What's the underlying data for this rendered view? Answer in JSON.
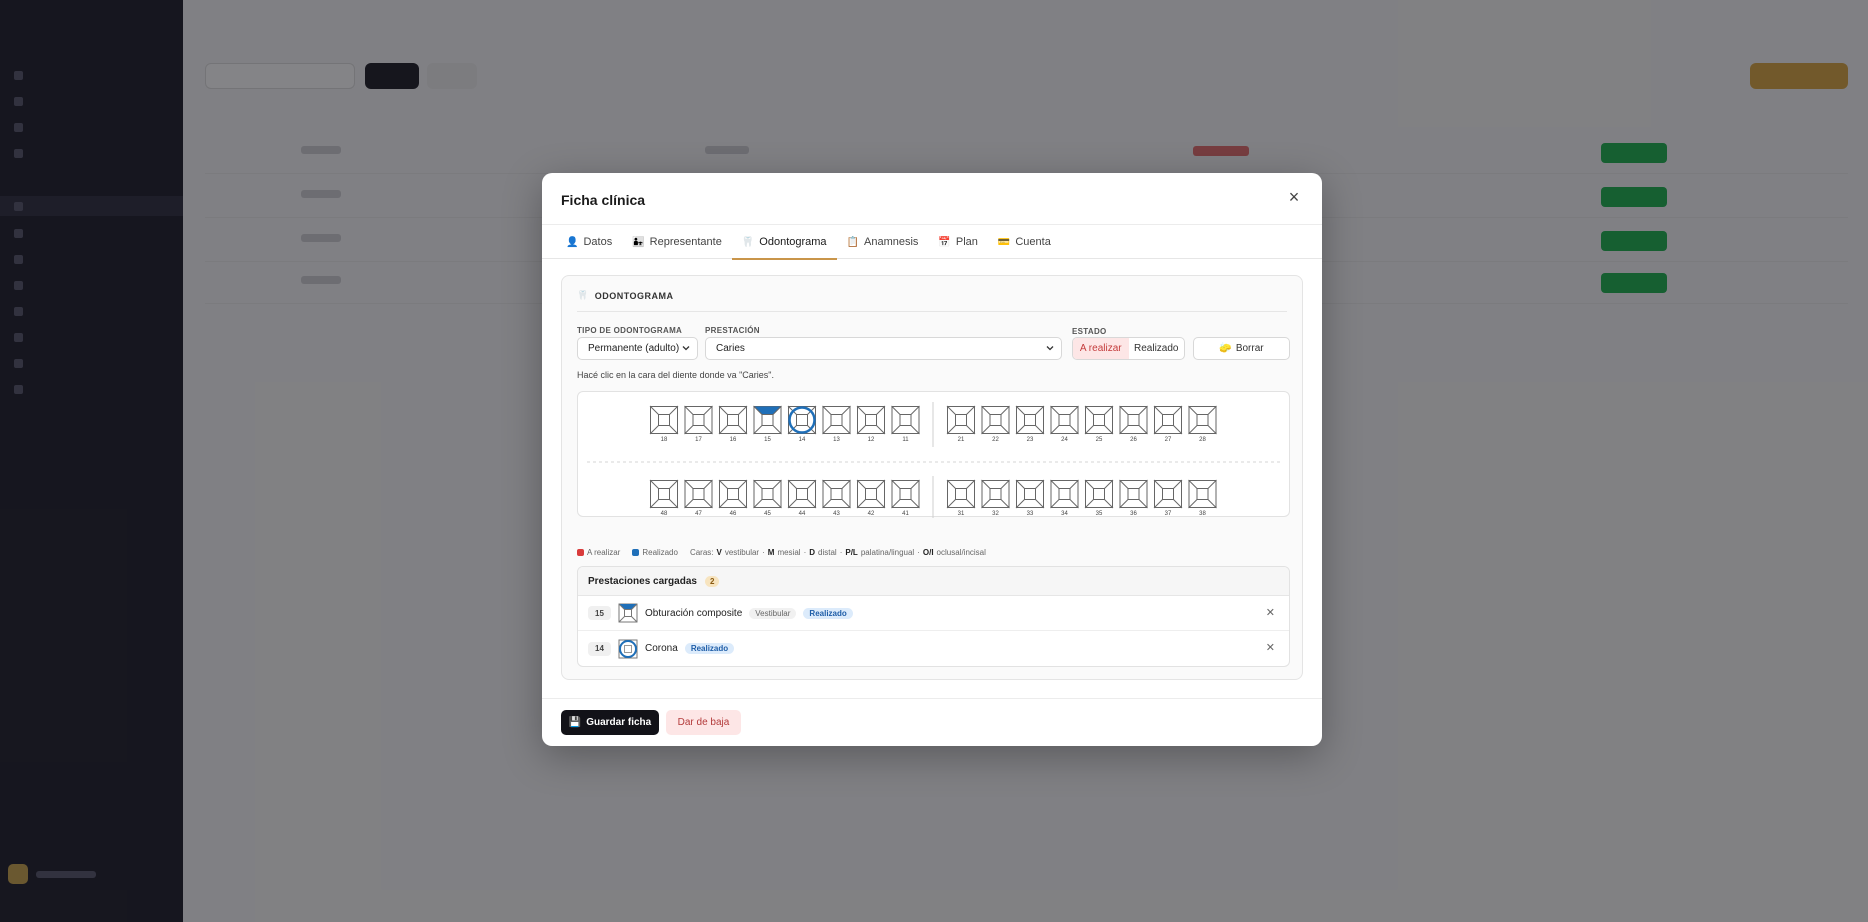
{
  "modal": {
    "title": "Ficha clínica",
    "tabs": [
      {
        "label": "Datos",
        "icon": "👤"
      },
      {
        "label": "Representante",
        "icon": "👨‍👧"
      },
      {
        "label": "Odontograma",
        "icon": "🦷"
      },
      {
        "label": "Anamnesis",
        "icon": "📋"
      },
      {
        "label": "Plan",
        "icon": "📅"
      },
      {
        "label": "Cuenta",
        "icon": "💳"
      }
    ],
    "active_tab": "Odontograma",
    "section_title": "ODONTOGRAMA",
    "section_icon": "🦷",
    "tipo_label": "TIPO DE ODONTOGRAMA",
    "tipo_value": "Permanente (adulto)",
    "prestacion_label": "PRESTACIÓN",
    "prestacion_value": "Caries",
    "estado_label": "ESTADO",
    "estado_a_realizar": "A realizar",
    "estado_realizado": "Realizado",
    "estado_selected": "A realizar",
    "borrar_label": "Borrar",
    "hint": "Hacé clic en la cara del diente donde va \"Caries\".",
    "teeth": {
      "upper_right": [
        "18",
        "17",
        "16",
        "15",
        "14",
        "13",
        "12",
        "11"
      ],
      "upper_left": [
        "21",
        "22",
        "23",
        "24",
        "25",
        "26",
        "27",
        "28"
      ],
      "lower_right": [
        "48",
        "47",
        "46",
        "45",
        "44",
        "43",
        "42",
        "41"
      ],
      "lower_left": [
        "31",
        "32",
        "33",
        "34",
        "35",
        "36",
        "37",
        "38"
      ]
    },
    "marked_teeth": {
      "15": {
        "face": "vestibular",
        "estado": "Realizado",
        "color": "#1f6fb8"
      },
      "14": {
        "type": "corona",
        "estado": "Realizado",
        "color": "#1f6fb8"
      }
    },
    "legend": {
      "a_realizar": "A realizar",
      "a_realizar_color": "#d93b3b",
      "realizado": "Realizado",
      "realizado_color": "#1f6fb8",
      "caras_prefix": "Caras:",
      "v_key": "V",
      "v_text": "vestibular",
      "m_key": "M",
      "m_text": "mesial",
      "d_key": "D",
      "d_text": "distal",
      "pl_key": "P/L",
      "pl_text": "palatina/lingual",
      "oi_key": "O/I",
      "oi_text": "oclusal/incisal"
    },
    "prestaciones": {
      "title": "Prestaciones cargadas",
      "count": "2",
      "items": [
        {
          "tooth": "15",
          "name": "Obturación composite",
          "face": "Vestibular",
          "estado": "Realizado"
        },
        {
          "tooth": "14",
          "name": "Corona",
          "face": "",
          "estado": "Realizado"
        }
      ]
    },
    "footer": {
      "save_label": "Guardar ficha",
      "save_icon": "💾",
      "baja_label": "Dar de baja"
    }
  }
}
